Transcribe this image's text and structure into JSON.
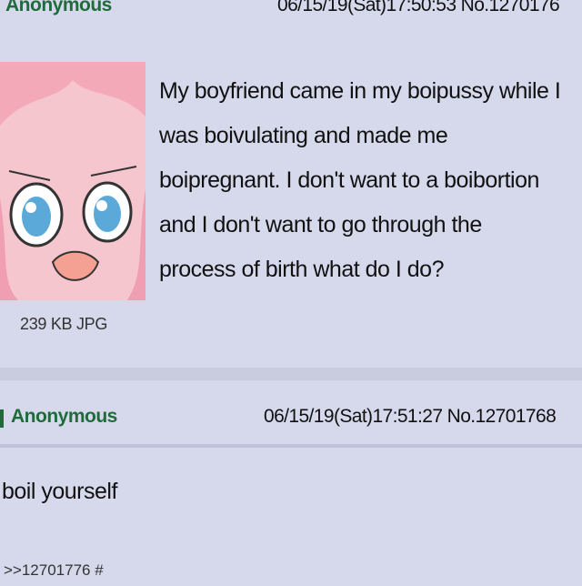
{
  "colors": {
    "post_bg": "#d6d9ec",
    "page_bg": "#c9ccdf",
    "name": "#1f6b3a",
    "text": "#111111"
  },
  "posts": [
    {
      "name": "Anonymous",
      "datetime": "06/15/19(Sat)17:50:53 No.1270176",
      "file_info": "239 KB JPG",
      "body_lines": [
        "My boyfriend came in my boipussy while I",
        "was boivulating and made me",
        "boipregnant. I don't want to a boibortion",
        "and I don't want to go through the",
        "process of birth what do I do?"
      ]
    },
    {
      "name": "Anonymous",
      "datetime": "06/15/19(Sat)17:51:27 No.12701768",
      "body": "boil yourself",
      "reply_link": ">>12701776 #"
    }
  ]
}
